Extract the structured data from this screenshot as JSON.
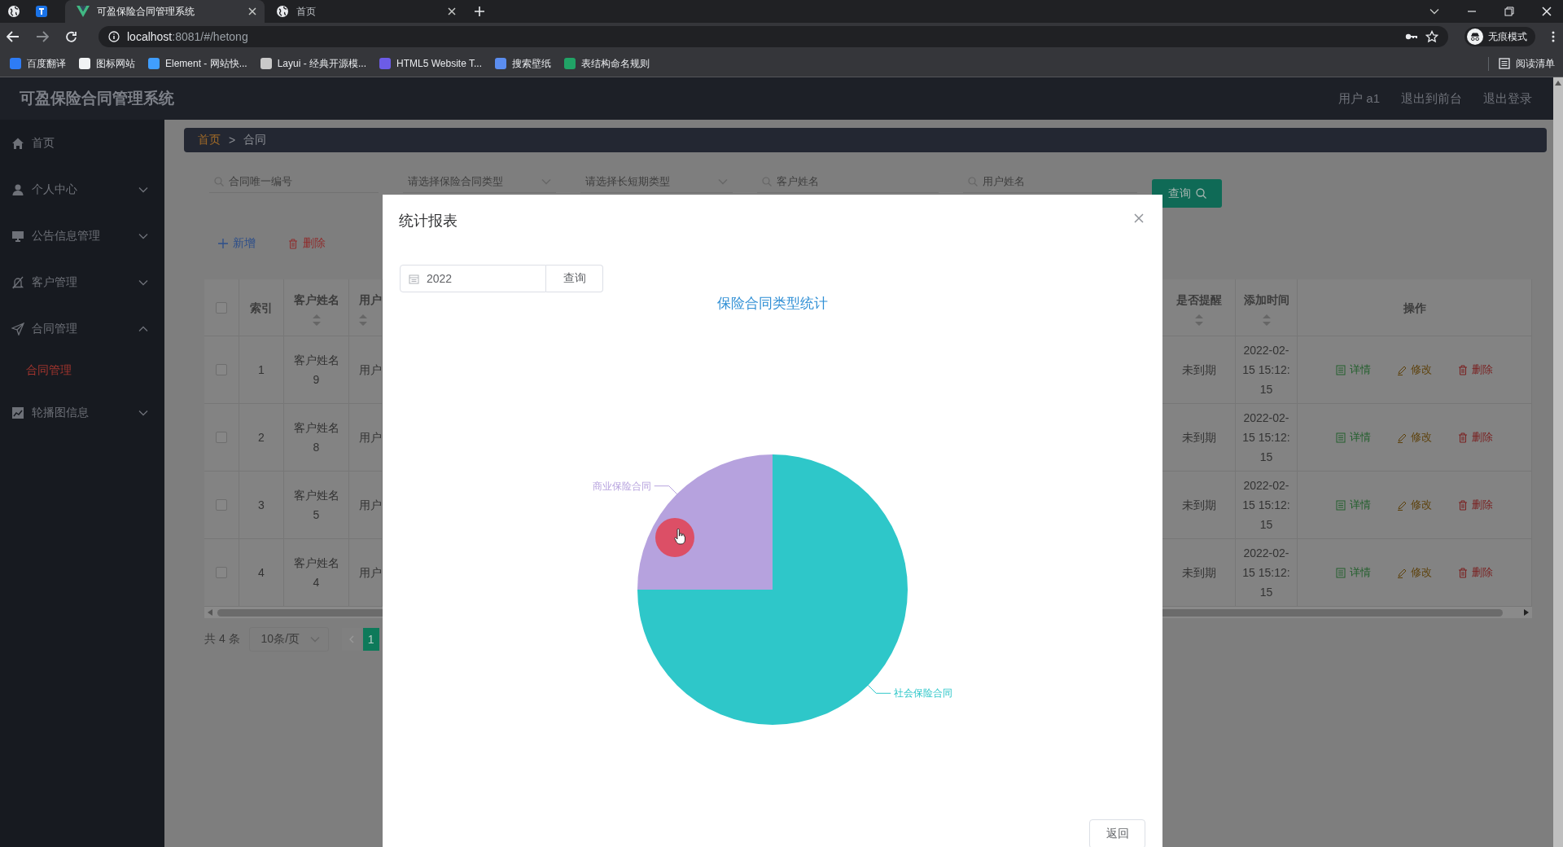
{
  "browser": {
    "tabs": [
      {
        "title": "可盈保险合同管理系统",
        "selected": true
      },
      {
        "title": "首页",
        "selected": false
      }
    ],
    "address": {
      "host": "localhost",
      "path": ":8081/#/hetong"
    },
    "profile": "无痕模式",
    "bookmarks": [
      {
        "label": "百度翻译",
        "color": "#2e7cf6"
      },
      {
        "label": "图标网站",
        "color": "#f1f3f4"
      },
      {
        "label": "Element - 网站快...",
        "color": "#409eff"
      },
      {
        "label": "Layui - 经典开源模...",
        "color": "#c9c9c9"
      },
      {
        "label": "HTML5 Website T...",
        "color": "#6c5ce7"
      },
      {
        "label": "搜索壁纸",
        "color": "#5b8def"
      },
      {
        "label": "表结构命名规则",
        "color": "#21a366"
      }
    ],
    "reading_list": "阅读清单"
  },
  "app": {
    "title": "可盈保险合同管理系统",
    "user": "用户 a1",
    "links": [
      "退出到前台",
      "退出登录"
    ]
  },
  "sidebar": {
    "items": [
      {
        "label": "首页",
        "kind": "link"
      },
      {
        "label": "个人中心",
        "kind": "menu",
        "expanded": false
      },
      {
        "label": "公告信息管理",
        "kind": "menu",
        "expanded": false
      },
      {
        "label": "客户管理",
        "kind": "menu",
        "expanded": false
      },
      {
        "label": "合同管理",
        "kind": "menu",
        "expanded": true,
        "children": [
          {
            "label": "合同管理",
            "selected": true
          }
        ]
      },
      {
        "label": "轮播图信息",
        "kind": "menu",
        "expanded": false
      }
    ]
  },
  "breadcrumb": {
    "items": [
      "首页",
      "合同"
    ],
    "separator": ">"
  },
  "filters": [
    {
      "placeholder": "合同唯一编号",
      "kind": "search"
    },
    {
      "placeholder": "请选择保险合同类型",
      "kind": "select"
    },
    {
      "placeholder": "请选择长短期类型",
      "kind": "select"
    },
    {
      "placeholder": "客户姓名",
      "kind": "search"
    },
    {
      "placeholder": "用户姓名",
      "kind": "search"
    }
  ],
  "search_button": "查询",
  "actions": [
    {
      "label": "新增",
      "kind": "add"
    },
    {
      "label": "删除",
      "kind": "delete"
    }
  ],
  "table": {
    "select_all": false,
    "columns": [
      {
        "label": "索引",
        "sortable": false
      },
      {
        "label": "客户姓名",
        "sortable": true
      },
      {
        "label": "用户",
        "sortable": true
      },
      {
        "label": "是否提醒",
        "sortable": true
      },
      {
        "label": "添加时间",
        "sortable": true
      },
      {
        "label": "操作",
        "sortable": false
      }
    ],
    "rows": [
      {
        "checked": false,
        "index": "1",
        "customer": "客户姓名9",
        "user": "用户",
        "remind": "未到期",
        "added": "2022-02-15 15:12:15",
        "actions": [
          {
            "label": "详情",
            "kind": "detail"
          },
          {
            "label": "修改",
            "kind": "edit"
          },
          {
            "label": "删除",
            "kind": "delete"
          }
        ]
      },
      {
        "checked": false,
        "index": "2",
        "customer": "客户姓名8",
        "user": "用户",
        "remind": "未到期",
        "added": "2022-02-15 15:12:15",
        "actions": [
          {
            "label": "详情",
            "kind": "detail"
          },
          {
            "label": "修改",
            "kind": "edit"
          },
          {
            "label": "删除",
            "kind": "delete"
          }
        ]
      },
      {
        "checked": false,
        "index": "3",
        "customer": "客户姓名5",
        "user": "用户",
        "remind": "未到期",
        "added": "2022-02-15 15:12:15",
        "actions": [
          {
            "label": "详情",
            "kind": "detail"
          },
          {
            "label": "修改",
            "kind": "edit"
          },
          {
            "label": "删除",
            "kind": "delete"
          }
        ]
      },
      {
        "checked": false,
        "index": "4",
        "customer": "客户姓名4",
        "user": "用户",
        "remind": "未到期",
        "added": "2022-02-15 15:12:15",
        "actions": [
          {
            "label": "详情",
            "kind": "detail"
          },
          {
            "label": "修改",
            "kind": "edit"
          },
          {
            "label": "删除",
            "kind": "delete"
          }
        ]
      }
    ]
  },
  "pagination": {
    "total": "共 4 条",
    "page_size": "10条/页",
    "pages": [
      {
        "label": "1",
        "selected": true
      }
    ]
  },
  "modal": {
    "title": "统计报表",
    "year": "2022",
    "query": "查询",
    "back": "返回",
    "chart_data": {
      "type": "pie",
      "title": "保险合同类型统计",
      "categories": [
        "社会保险合同",
        "商业保险合同"
      ],
      "values": [
        75,
        25
      ],
      "colors": [
        "#2ec7c9",
        "#b6a2de"
      ]
    }
  }
}
